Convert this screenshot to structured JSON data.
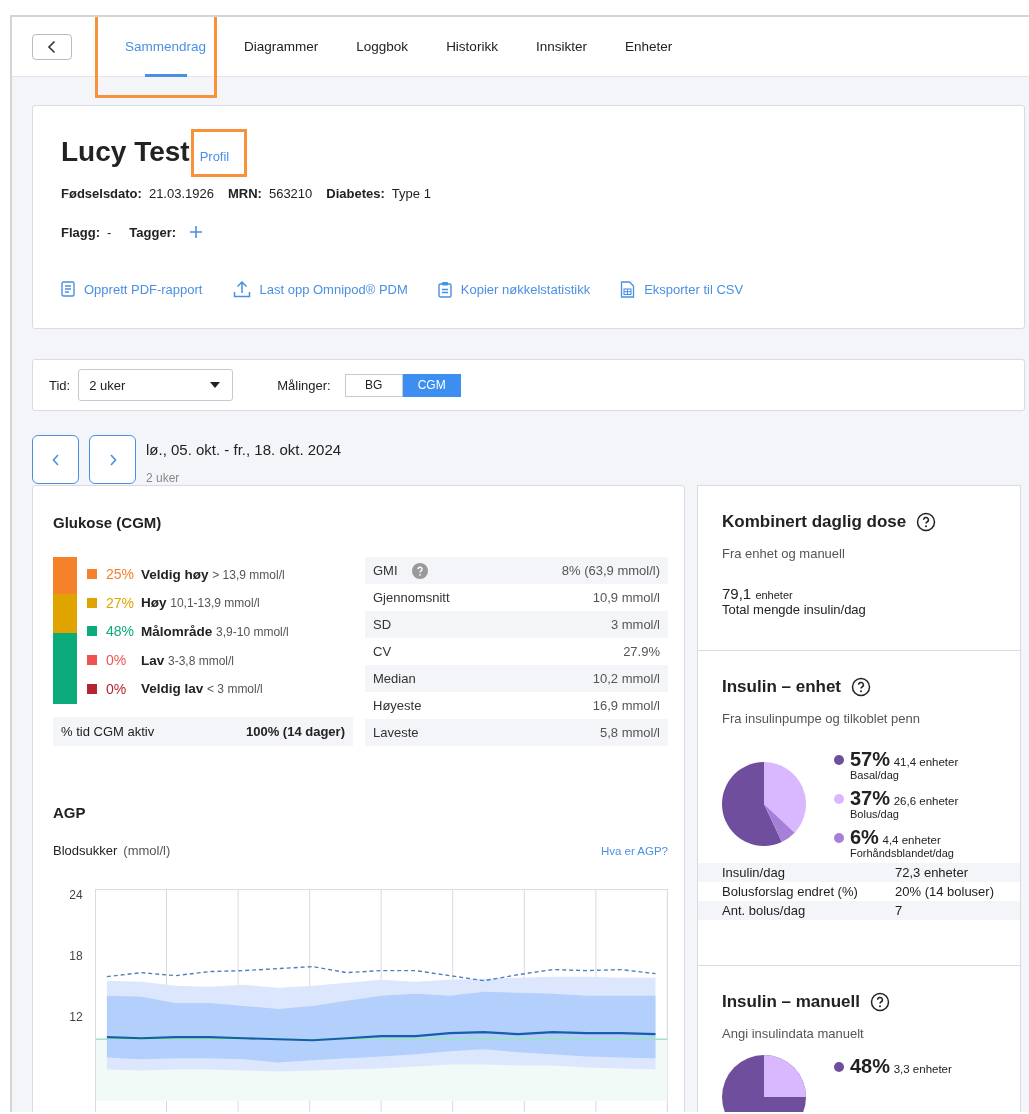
{
  "nav": {
    "tabs": [
      {
        "label": "Sammendrag",
        "selected": true,
        "highlighted": true
      },
      {
        "label": "Diagrammer",
        "selected": false,
        "highlighted": false
      },
      {
        "label": "Loggbok",
        "selected": false,
        "highlighted": false
      },
      {
        "label": "Historikk",
        "selected": false,
        "highlighted": false
      },
      {
        "label": "Innsikter",
        "selected": false,
        "highlighted": false
      },
      {
        "label": "Enheter",
        "selected": false,
        "highlighted": false
      }
    ]
  },
  "patient": {
    "name": "Lucy Test",
    "profile_link": {
      "label": "Profil",
      "highlighted": true
    },
    "fields": [
      {
        "label": "Fødselsdato:",
        "value": "21.03.1926"
      },
      {
        "label": "MRN:",
        "value": "563210"
      },
      {
        "label": "Diabetes:",
        "value": "Type 1"
      }
    ],
    "flags": {
      "label": "Flagg:",
      "value": "-"
    },
    "tags": {
      "label": "Tagger:"
    },
    "actions": [
      {
        "kind": "document",
        "label": "Opprett PDF-rapport"
      },
      {
        "kind": "upload",
        "label": "Last opp Omnipod® PDM"
      },
      {
        "kind": "clipboard",
        "label": "Kopier nøkkelstatistikk"
      },
      {
        "kind": "table",
        "label": "Eksporter til CSV"
      }
    ]
  },
  "filters": {
    "time": {
      "label": "Tid:",
      "value": "2 uker"
    },
    "measurements": {
      "label": "Målinger:",
      "options": [
        {
          "label": "BG",
          "selected": false
        },
        {
          "label": "CGM",
          "selected": true
        }
      ]
    }
  },
  "date_range": {
    "title": "lø., 05. okt. - fr., 18. okt. 2024",
    "subtitle": "2 uker"
  },
  "glucose": {
    "title": "Glukose (CGM)",
    "ranges": [
      {
        "percent": "25%",
        "name": "Veldig høy",
        "range": "> 13,9 mmol/l",
        "color": "#f5812a",
        "level": 0.25
      },
      {
        "percent": "27%",
        "name": "Høy",
        "range": "10,1-13,9 mmol/l",
        "color": "#e0a400",
        "level": 0.27
      },
      {
        "percent": "48%",
        "name": "Målområde",
        "range": "3,9-10 mmol/l",
        "color": "#0bab7c",
        "level": 0.48
      },
      {
        "percent": "0%",
        "name": "Lav",
        "range": "3-3,8 mmol/l",
        "color": "#f05252",
        "level": 0
      },
      {
        "percent": "0%",
        "name": "Veldig lav",
        "range": "< 3 mmol/l",
        "color": "#b32631",
        "level": 0
      }
    ],
    "active": {
      "label": "% tid CGM aktiv",
      "value": "100% (14 dager)"
    },
    "stats": [
      {
        "label": "GMI",
        "value": "8% (63,9 mmol/l)",
        "help": true
      },
      {
        "label": "Gjennomsnitt",
        "value": "10,9 mmol/l",
        "help": false
      },
      {
        "label": "SD",
        "value": "3 mmol/l",
        "help": false
      },
      {
        "label": "CV",
        "value": "27.9%",
        "help": false
      },
      {
        "label": "Median",
        "value": "10,2 mmol/l",
        "help": false
      },
      {
        "label": "Høyeste",
        "value": "16,9 mmol/l",
        "help": false
      },
      {
        "label": "Laveste",
        "value": "5,8 mmol/l",
        "help": false
      }
    ]
  },
  "agp": {
    "title": "AGP",
    "ylabel": "Blodsukker",
    "unit": "(mmol/l)",
    "link": "Hva er AGP?",
    "y_ticks": [
      "24",
      "18",
      "12"
    ]
  },
  "combined_dose": {
    "title": "Kombinert daglig dose",
    "subtitle": "Fra enhet og manuell",
    "total": "79,1",
    "unit": "enheter",
    "caption": "Total mengde insulin/dag"
  },
  "insulin_device": {
    "title": "Insulin – enhet",
    "subtitle": "Fra insulinpumpe og tilkoblet penn",
    "chart_data": {
      "type": "pie",
      "categories": [
        "Basal/dag",
        "Bolus/dag",
        "Forhåndsblandet/dag"
      ],
      "values": [
        57,
        37,
        6
      ]
    },
    "legend": [
      {
        "percent": "57%",
        "amount": "41,4 enheter",
        "color": "#6f4e9e"
      },
      {
        "percent": "37%",
        "amount": "26,6 enheter",
        "color": "#d9b8ff"
      },
      {
        "percent": "6%",
        "amount": "4,4 enheter",
        "color": "#a57fd8"
      }
    ],
    "stats": [
      {
        "label": "Insulin/dag",
        "value": "72,3 enheter"
      },
      {
        "label": "Bolusforslag endret (%)",
        "value": "20% (14 boluser)"
      },
      {
        "label": "Ant. bolus/dag",
        "value": "7"
      }
    ]
  },
  "insulin_manual": {
    "title": "Insulin – manuell",
    "subtitle": "Angi insulindata manuelt",
    "legend": [
      {
        "percent": "48%",
        "amount": "3,3 enheter",
        "color": "#6f4e9e"
      }
    ]
  }
}
